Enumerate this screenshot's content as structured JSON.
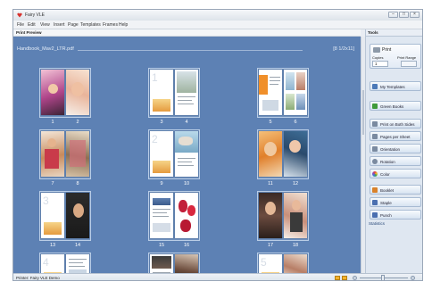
{
  "window": {
    "title": "Fairy VLE"
  },
  "menus": [
    "File",
    "Edit",
    "View",
    "Insert",
    "Page",
    "Templates",
    "Frames",
    "Help"
  ],
  "section_label": "Print Preview",
  "document": {
    "name": "Handbook_Mav2_LTR.pdf",
    "page_count": "[8 1/2x11]"
  },
  "page_numbers": [
    "1",
    "2",
    "3",
    "4",
    "5",
    "6",
    "7",
    "8",
    "9",
    "10",
    "11",
    "12",
    "13",
    "14",
    "15",
    "16",
    "17",
    "18"
  ],
  "tools": {
    "header": "Tools",
    "print_label": "Print",
    "copies_label": "Copies",
    "copies_value": "1",
    "print_range_label": "Print Range",
    "items": [
      {
        "label": "My Templates",
        "icon": "templates-icon",
        "color": "#4b79b8"
      },
      {
        "label": "Green Books",
        "icon": "green-books-icon",
        "color": "#3f9b3a"
      },
      {
        "label": "Print on Both Sides",
        "icon": "duplex-icon",
        "color": "#7a8aa0"
      },
      {
        "label": "Pages per Sheet",
        "icon": "pages-per-sheet-icon",
        "color": "#7a8aa0"
      },
      {
        "label": "Orientation",
        "icon": "orientation-icon",
        "color": "#7a8aa0"
      },
      {
        "label": "Rotation",
        "icon": "rotation-icon",
        "color": "#7a8aa0"
      },
      {
        "label": "Color",
        "icon": "color-wheel-icon",
        "color": "#e0433b"
      },
      {
        "label": "Booklet",
        "icon": "booklet-icon",
        "color": "#d9822b"
      },
      {
        "label": "Staple",
        "icon": "staple-icon",
        "color": "#4a6fb0"
      },
      {
        "label": "Punch",
        "icon": "punch-icon",
        "color": "#4a6fb0"
      }
    ],
    "statistics_label": "Statistics"
  },
  "status": {
    "text": "Printer: Fairy VLE Demo"
  }
}
